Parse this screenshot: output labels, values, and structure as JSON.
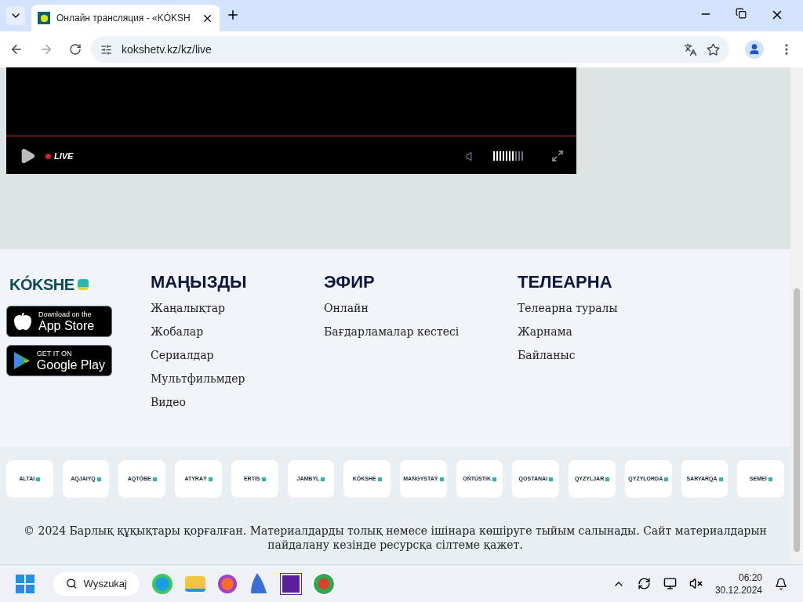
{
  "browser": {
    "tab_title": "Онлайн трансляция - «KÓKSH",
    "url": "kokshetv.kz/kz/live"
  },
  "player": {
    "live_label": "LIVE",
    "progress": {
      "level": 1
    },
    "volume": {
      "level": 0.7
    }
  },
  "footer": {
    "logo": "KÓKSHE",
    "stores": [
      {
        "kind": "apple",
        "small": "Download on the",
        "big": "App Store"
      },
      {
        "kind": "google",
        "small": "GET IT ON",
        "big": "Google Play"
      }
    ],
    "columns": [
      {
        "heading": "МАҢЫЗДЫ",
        "links": [
          "Жаңалықтар",
          "Жобалар",
          "Сериалдар",
          "Мультфильмдер",
          "Видео"
        ]
      },
      {
        "heading": "ЭФИР",
        "links": [
          "Онлайн",
          "Бағдарламалар кестесі"
        ]
      },
      {
        "heading": "ТЕЛЕАРНА",
        "links": [
          "Телеарна туралы",
          "Жарнама",
          "Байланыс"
        ]
      }
    ]
  },
  "channels": [
    "ALTAI",
    "AQJAIYQ",
    "AQTÓBE",
    "ATYRAÝ",
    "ERTIS",
    "JAMBYL",
    "KÓKSHE",
    "MAŃGYSTAÝ",
    "OŃTÚSTIK",
    "QOSTANAI",
    "QYZYLJAR",
    "QYZYLORDA",
    "SARYARQA",
    "SEMEI"
  ],
  "copyright": "© 2024 Барлық құқықтары қорғалған. Материалдарды толық немесе ішінара көшіруге тыйым салынады. Сайт материалдарын пайдалану кезінде ресурсқа сілтеме қажет.",
  "taskbar": {
    "search": "Wyszukaj",
    "time": "06:20",
    "date": "30.12.2024"
  }
}
